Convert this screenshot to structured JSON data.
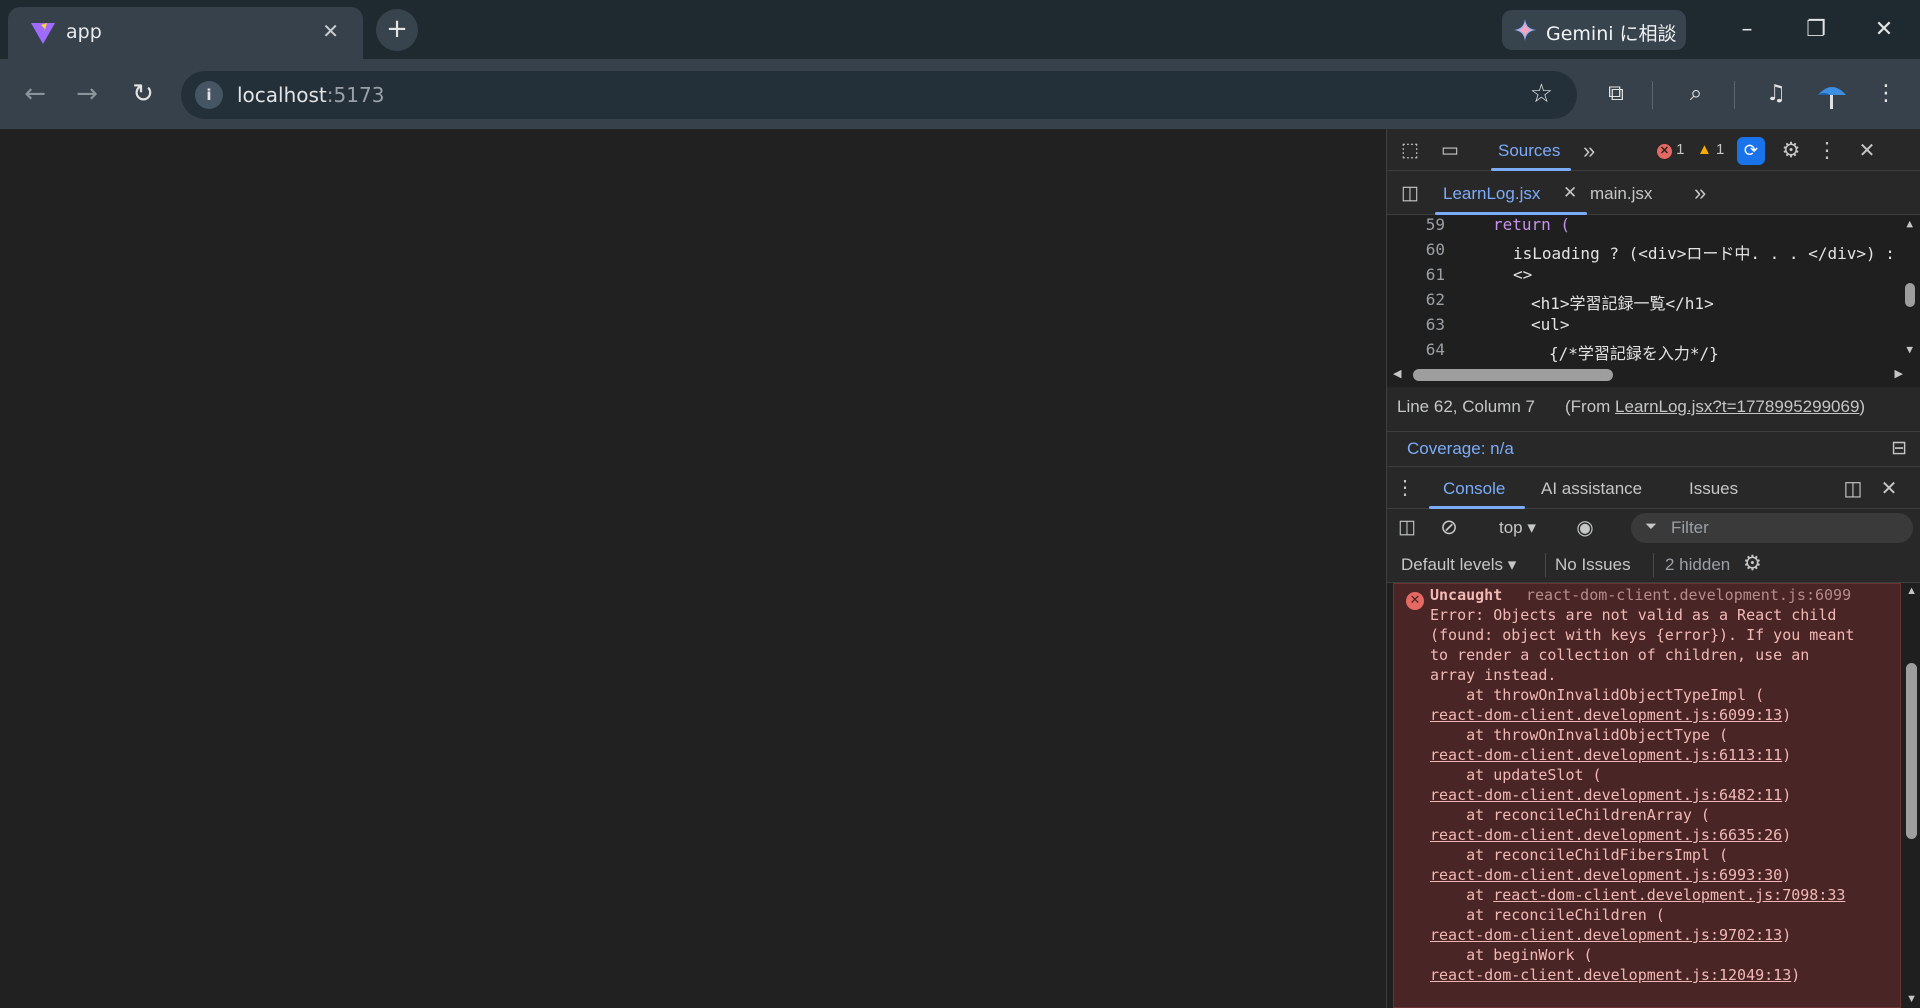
{
  "browser": {
    "tab_title": "app",
    "new_tab": "+",
    "gemini_label": "Gemini に相談",
    "url_host": "localhost",
    "url_port": ":5173"
  },
  "devtools": {
    "main_tab": "Sources",
    "more_tabs": "»",
    "error_count": "1",
    "warning_count": "1",
    "files": [
      "LearnLog.jsx",
      "main.jsx"
    ],
    "code_lines": [
      {
        "n": "59",
        "text": "return ("
      },
      {
        "n": "60",
        "text": "isLoading ? (<div>ロード中. . . </div>) :"
      },
      {
        "n": "61",
        "text": "<>"
      },
      {
        "n": "62",
        "text": "<h1>学習記録一覧</h1>"
      },
      {
        "n": "63",
        "text": "<ul>"
      },
      {
        "n": "64",
        "text": "{/*学習記録を入力*/}"
      }
    ],
    "cursor_position": "Line 62, Column 7",
    "from_prefix": "(From ",
    "from_link": "LearnLog.jsx?t=1778995299069",
    "from_suffix": ")",
    "coverage": "Coverage: n/a",
    "drawer_tabs": [
      "Console",
      "AI assistance",
      "Issues"
    ],
    "context": "top",
    "filter_placeholder": "Filter",
    "levels": "Default levels",
    "issues": "No Issues",
    "hidden": "2 hidden",
    "error": {
      "label": "Uncaught",
      "source": "react-dom-client.development.js:6099",
      "message": [
        "Error: Objects are not valid as a React child",
        "(found: object with keys {error}). If you meant",
        "to render a collection of children, use an",
        "array instead."
      ],
      "stack": [
        {
          "at": "    at throwOnInvalidObjectTypeImpl (",
          "link": "react-dom-client.development.js:6099:13",
          "end": ")"
        },
        {
          "at": "    at throwOnInvalidObjectType (",
          "link": "react-dom-client.development.js:6113:11",
          "end": ")"
        },
        {
          "at": "    at updateSlot (",
          "link": "react-dom-client.development.js:6482:11",
          "end": ")"
        },
        {
          "at": "    at reconcileChildrenArray (",
          "link": "react-dom-client.development.js:6635:26",
          "end": ")"
        },
        {
          "at": "    at reconcileChildFibersImpl (",
          "link": "react-dom-client.development.js:6993:30",
          "end": ")"
        },
        {
          "at": "    at ",
          "link": "react-dom-client.development.js:7098:33",
          "end": ""
        },
        {
          "at": "    at reconcileChildren (",
          "link": "react-dom-client.development.js:9702:13",
          "end": ")"
        },
        {
          "at": "    at beginWork (",
          "link": "react-dom-client.development.js:12049:13",
          "end": ")"
        }
      ]
    }
  }
}
